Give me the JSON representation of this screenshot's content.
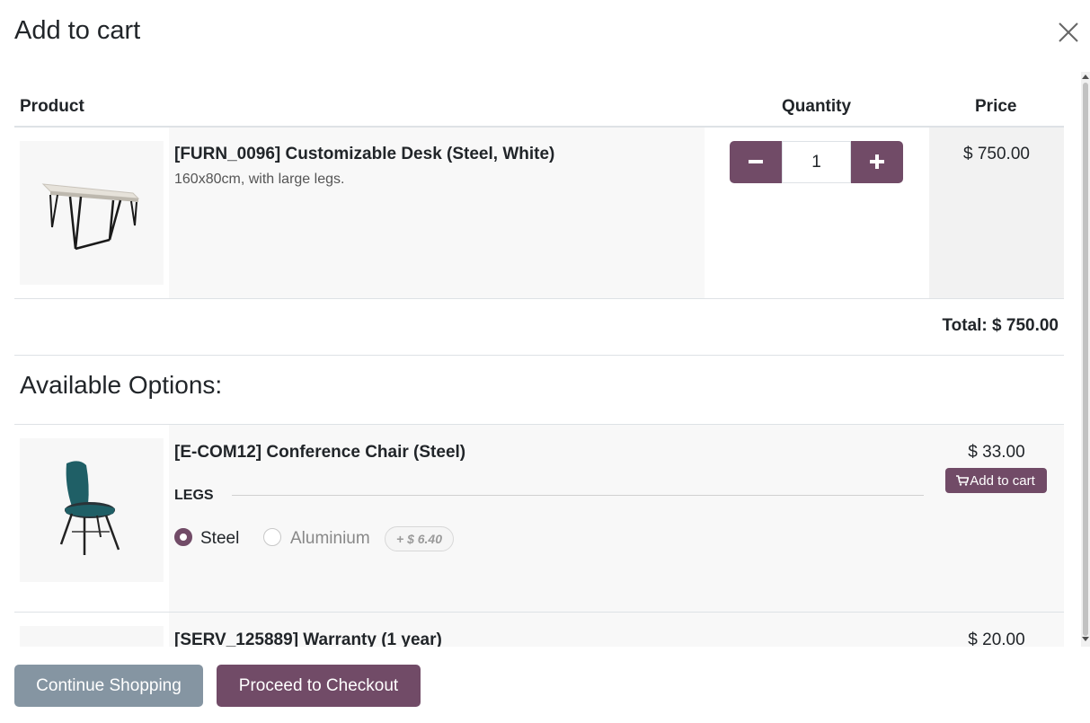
{
  "modal": {
    "title": "Add to cart",
    "close_icon": "close-icon"
  },
  "table": {
    "headers": {
      "product": "Product",
      "quantity": "Quantity",
      "price": "Price"
    }
  },
  "main_product": {
    "name": "[FURN_0096] Customizable Desk (Steel, White)",
    "description": "160x80cm, with large legs.",
    "quantity": "1",
    "price": "$ 750.00",
    "image_icon": "desk-image"
  },
  "total": "Total: $ 750.00",
  "options": {
    "title": "Available Options:",
    "items": [
      {
        "name": "[E-COM12] Conference Chair (Steel)",
        "price": "$ 33.00",
        "add_label": "Add to cart",
        "attribute_label": "LEGS",
        "values": [
          {
            "label": "Steel",
            "selected": true
          },
          {
            "label": "Aluminium",
            "selected": false,
            "extra": "+ $ 6.40"
          }
        ],
        "image_icon": "chair-image"
      },
      {
        "name": "[SERV_125889] Warranty (1 year)",
        "price": "$ 20.00"
      }
    ]
  },
  "footer": {
    "continue_label": "Continue Shopping",
    "checkout_label": "Proceed to Checkout"
  },
  "colors": {
    "primary": "#714b67",
    "secondary": "#8595a2"
  }
}
